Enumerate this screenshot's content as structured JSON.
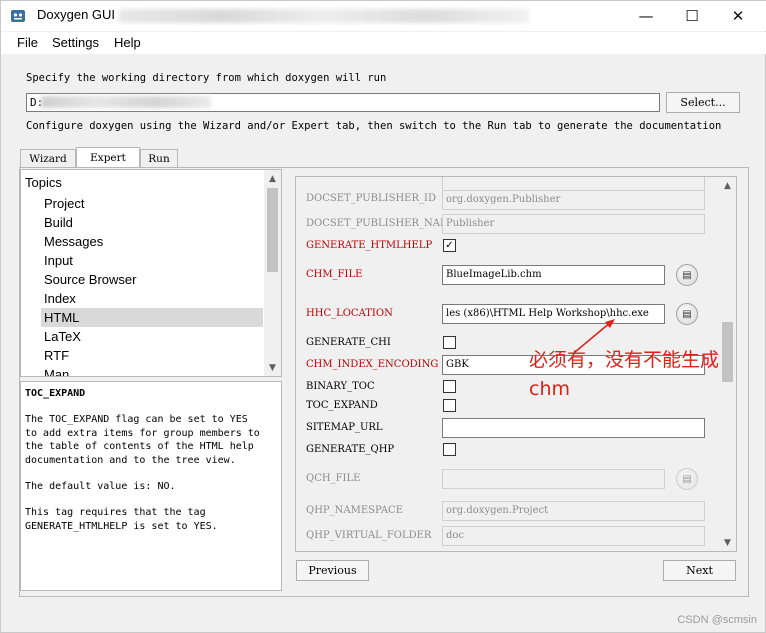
{
  "window": {
    "title": "Doxygen GUI",
    "controls": {
      "minimize": "—",
      "maximize": "☐",
      "close": "✕"
    }
  },
  "menu": [
    "File",
    "Settings",
    "Help"
  ],
  "instructions": {
    "line1": "Specify the working directory from which doxygen will run",
    "line2": "Configure doxygen using the Wizard and/or Expert tab, then switch to the Run tab to generate the documentation"
  },
  "working_dir": {
    "value": "D:",
    "select_label": "Select..."
  },
  "tabs": [
    {
      "label": "Wizard",
      "active": false
    },
    {
      "label": "Expert",
      "active": true
    },
    {
      "label": "Run",
      "active": false
    }
  ],
  "topics": {
    "header": "Topics",
    "items": [
      "Project",
      "Build",
      "Messages",
      "Input",
      "Source Browser",
      "Index",
      "HTML",
      "LaTeX",
      "RTF",
      "Man"
    ],
    "selected": "HTML"
  },
  "help": {
    "heading": "TOC_EXPAND",
    "p1": "The TOC_EXPAND flag can be set to YES\nto add extra items for group members to\nthe table of contents of the HTML help\ndocumentation and to the tree view.",
    "p2": "The default value is: NO.",
    "p3": "This tag requires that the tag\nGENERATE_HTMLHELP is set to YES."
  },
  "settings": {
    "docset_publisher_id": {
      "label": "DOCSET_PUBLISHER_ID",
      "value": "org.doxygen.Publisher"
    },
    "docset_publisher_name": {
      "label": "DOCSET_PUBLISHER_NAME",
      "value": "Publisher"
    },
    "generate_htmlhelp": {
      "label": "GENERATE_HTMLHELP",
      "checked": "✓"
    },
    "chm_file": {
      "label": "CHM_FILE",
      "value": "BlueImageLib.chm"
    },
    "hhc_location": {
      "label": "HHC_LOCATION",
      "value": "les (x86)\\HTML Help Workshop\\hhc.exe"
    },
    "generate_chi": {
      "label": "GENERATE_CHI"
    },
    "chm_index_encoding": {
      "label": "CHM_INDEX_ENCODING",
      "value": "GBK"
    },
    "binary_toc": {
      "label": "BINARY_TOC"
    },
    "toc_expand": {
      "label": "TOC_EXPAND"
    },
    "sitemap_url": {
      "label": "SITEMAP_URL",
      "value": ""
    },
    "generate_qhp": {
      "label": "GENERATE_QHP"
    },
    "qch_file": {
      "label": "QCH_FILE",
      "value": ""
    },
    "qhp_namespace": {
      "label": "QHP_NAMESPACE",
      "value": "org.doxygen.Project"
    },
    "qhp_virtual_folder": {
      "label": "QHP_VIRTUAL_FOLDER",
      "value": "doc"
    }
  },
  "nav": {
    "previous": "Previous",
    "next": "Next"
  },
  "annotation": {
    "line1": "必须有，没有不能生成",
    "line2": "chm"
  },
  "watermark": "CSDN @scmsin",
  "colors": {
    "required_label": "#c00000",
    "annotation": "#e0211a"
  }
}
